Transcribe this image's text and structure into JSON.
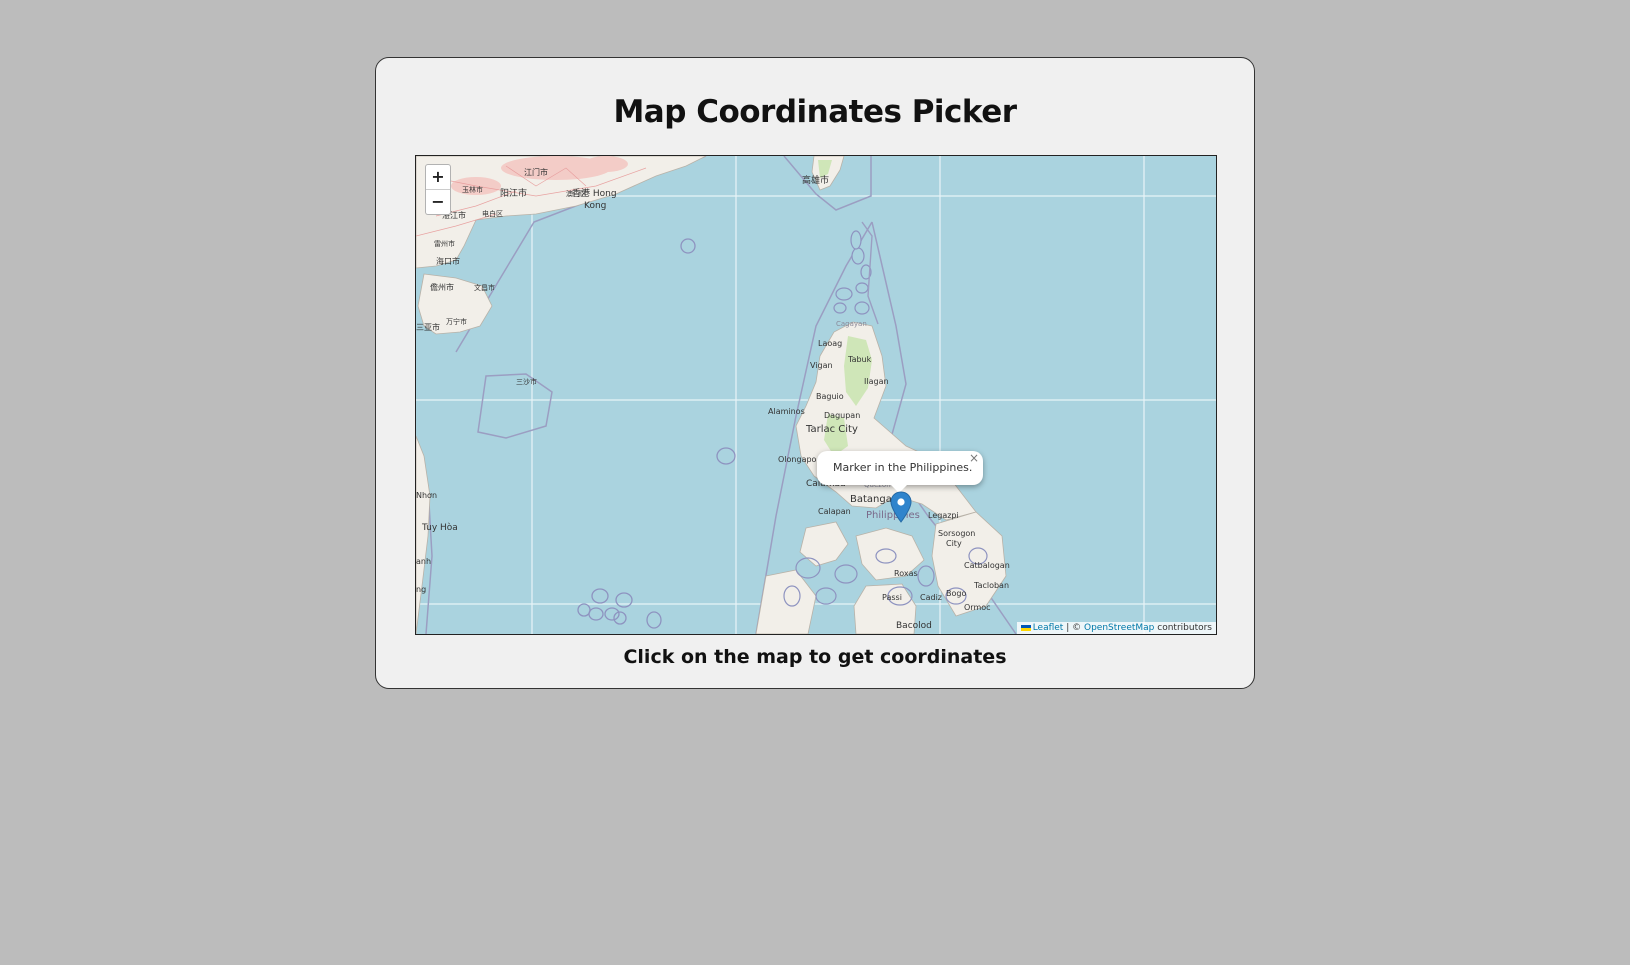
{
  "title": "Map Coordinates Picker",
  "caption": "Click on the map to get coordinates",
  "zoom": {
    "in_label": "+",
    "out_label": "−"
  },
  "popup": {
    "text": "Marker in the Philippines.",
    "close_label": "×"
  },
  "attribution": {
    "leaflet_label": "Leaflet",
    "separator": "| ©",
    "osm_label": "OpenStreetMap",
    "suffix": "contributors"
  },
  "map_labels": {
    "kaohsiung": "高雄市",
    "jiangmen": "江门市",
    "yangjiang": "阳江市",
    "hongkong_zh": "香港 Hong",
    "hongkong_en": "Kong",
    "aomen": "澳门区",
    "haikou": "海口市",
    "zhanjiang": "湛江市",
    "leizhou": "雷州市",
    "danzhou": "儋州市",
    "wenchang": "文昌市",
    "sanya": "三亚市",
    "wanning": "万宁市",
    "sansha": "三沙市",
    "dianbai": "电白区",
    "yulin": "玉林市",
    "laoag": "Laoag",
    "cagayan": "Cagayan",
    "tabuk": "Tabuk",
    "vigan": "Vigan",
    "ilagan": "Ilagan",
    "baguio": "Baguio",
    "alaminos": "Alaminos",
    "dagupan": "Dagupan",
    "tarlac": "Tarlac City",
    "olongapo": "Olongapo",
    "calamba": "Calamba",
    "quezon": "Quezon",
    "batangas": "Batangas",
    "calapan": "Calapan",
    "philippines": "Philippines",
    "legazpi": "Legazpi",
    "sorsogon": "Sorsogon",
    "sorsogon_city": "City",
    "catbalogan": "Catbalogan",
    "roxas": "Roxas",
    "tacloban": "Tacloban",
    "passi": "Passi",
    "cadiz": "Cadiz",
    "bogo": "Bogo",
    "ormoc": "Ormoc",
    "bacolod": "Bacolod",
    "tuyhoa": "Tuy Hòa",
    "nhon": "Nhơn",
    "anh": "anh",
    "ng": "ng"
  }
}
